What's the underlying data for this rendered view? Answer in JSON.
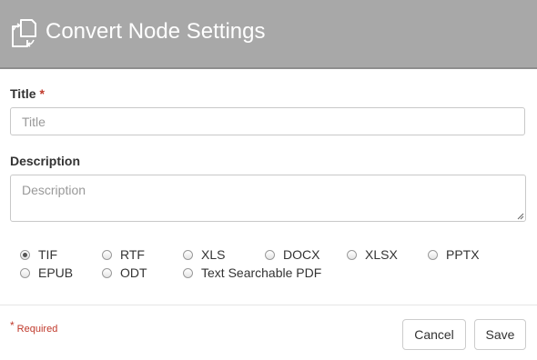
{
  "header": {
    "title": "Convert Node Settings",
    "icon": "convert-documents-icon"
  },
  "form": {
    "title_label": "Title",
    "required_marker": "*",
    "title_value": "",
    "title_placeholder": "Title",
    "description_label": "Description",
    "description_value": "",
    "description_placeholder": "Description"
  },
  "formats": {
    "selected": "TIF",
    "options": [
      "TIF",
      "RTF",
      "XLS",
      "DOCX",
      "XLSX",
      "PPTX",
      "EPUB",
      "ODT",
      "Text Searchable PDF"
    ]
  },
  "footer": {
    "required_marker": "*",
    "required_note": "Required",
    "cancel_label": "Cancel",
    "save_label": "Save"
  },
  "colors": {
    "header_bg": "#a8a8a8",
    "required": "#c0392b"
  }
}
